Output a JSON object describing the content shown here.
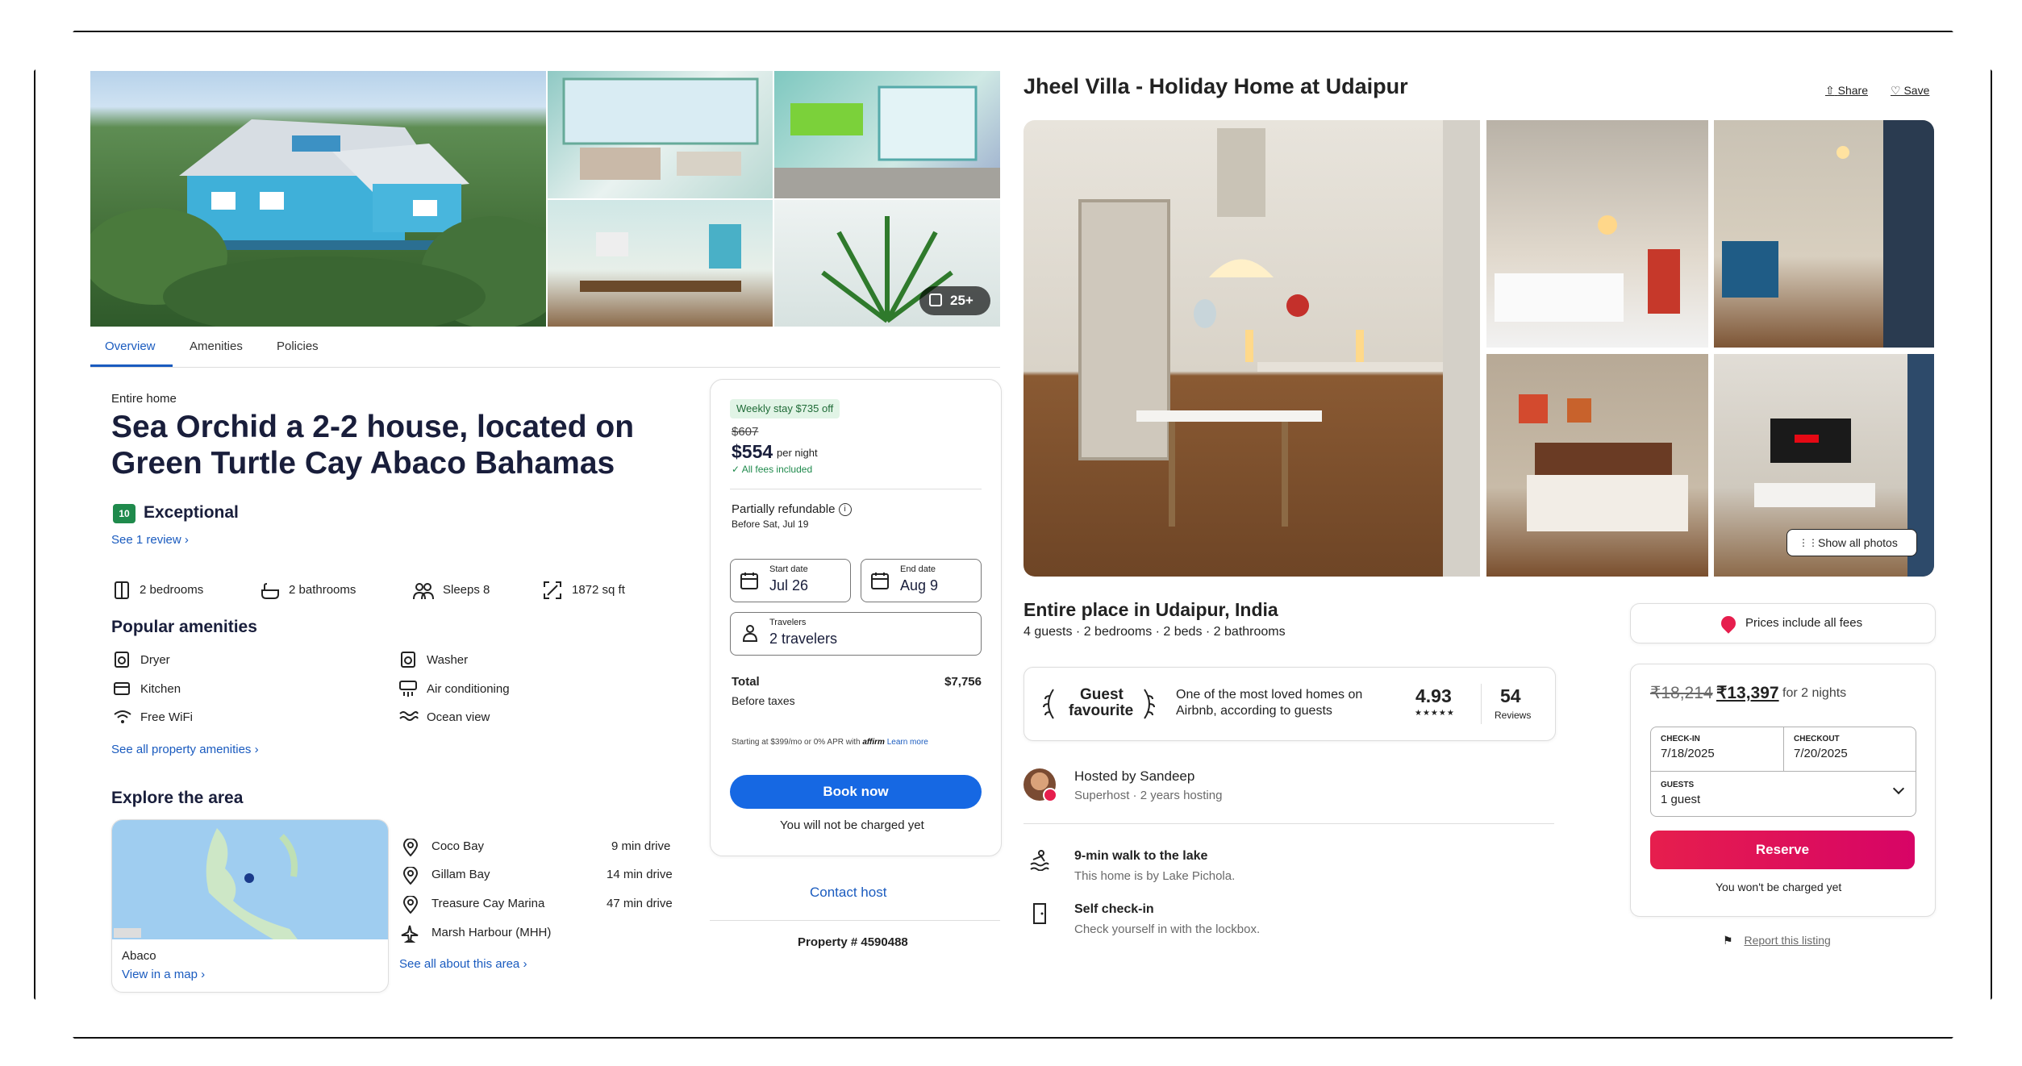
{
  "left": {
    "photo_badge": "25+",
    "tabs": [
      "Overview",
      "Amenities",
      "Policies"
    ],
    "property_type": "Entire home",
    "title_line1": "Sea Orchid a 2-2 house, located on",
    "title_line2": "Green Turtle Cay Abaco Bahamas",
    "rating_score": "10",
    "rating_label": "Exceptional",
    "review_link": "See 1 review",
    "facts": {
      "bedrooms": "2 bedrooms",
      "bathrooms": "2 bathrooms",
      "sleeps": "Sleeps 8",
      "area": "1872 sq ft"
    },
    "amenities_heading": "Popular amenities",
    "amenities": [
      "Dryer",
      "Washer",
      "Kitchen",
      "Air conditioning",
      "Free WiFi",
      "Ocean view"
    ],
    "amenities_link": "See all property amenities",
    "explore_heading": "Explore the area",
    "map_region": "Abaco",
    "map_link": "View in a map",
    "places": [
      {
        "name": "Coco Bay",
        "time": "9 min drive"
      },
      {
        "name": "Gillam Bay",
        "time": "14 min drive"
      },
      {
        "name": "Treasure Cay Marina",
        "time": "47 min drive"
      },
      {
        "name": "Marsh Harbour (MHH)",
        "time": ""
      }
    ],
    "area_link": "See all about this area",
    "booking": {
      "deal_badge": "Weekly stay $735 off",
      "old_price": "$607",
      "price": "$554",
      "per_night": "per night",
      "fees_note": "All fees included",
      "refund": "Partially refundable",
      "refund_date": "Before Sat, Jul 19",
      "start_label": "Start date",
      "start_value": "Jul 26",
      "end_label": "End date",
      "end_value": "Aug 9",
      "travelers_label": "Travelers",
      "travelers_value": "2 travelers",
      "total_label": "Total",
      "total_value": "$7,756",
      "before_taxes": "Before taxes",
      "financing": "Starting at $399/mo or 0% APR with",
      "financing_brand": "affirm",
      "learn_more": "Learn more",
      "book_button": "Book now",
      "no_charge": "You will not be charged yet"
    },
    "contact_host": "Contact host",
    "property_number": "Property # 4590488"
  },
  "right": {
    "title": "Jheel Villa - Holiday Home at Udaipur",
    "share": "Share",
    "save": "Save",
    "show_all_photos": "Show all photos",
    "place_title": "Entire place in Udaipur, India",
    "place_summary": "4 guests · 2 bedrooms · 2 beds · 2 bathrooms",
    "guest_fav_line1": "Guest",
    "guest_fav_line2": "favourite",
    "loved_line1": "One of the most loved homes on",
    "loved_line2": "Airbnb, according to guests",
    "rating": "4.93",
    "stars": "★★★★★",
    "reviews_count": "54",
    "reviews_label": "Reviews",
    "host_line": "Hosted by Sandeep",
    "host_sub": "Superhost · 2 years hosting",
    "feature1_title": "9-min walk to the lake",
    "feature1_sub": "This home is by Lake Pichola.",
    "feature2_title": "Self check-in",
    "feature2_sub": "Check yourself in with the lockbox.",
    "fees_banner": "Prices include all fees",
    "old_price": "₹18,214",
    "price": "₹13,397",
    "price_suffix": "for 2 nights",
    "checkin_label": "CHECK-IN",
    "checkin_value": "7/18/2025",
    "checkout_label": "CHECKOUT",
    "checkout_value": "7/20/2025",
    "guests_label": "GUESTS",
    "guests_value": "1 guest",
    "reserve": "Reserve",
    "no_charge": "You won't be charged yet",
    "report": "Report this listing"
  },
  "colors": {
    "expedia_blue": "#1668e3",
    "airbnb_pink": "#e61e4d",
    "rating_green": "#1f8a4c"
  }
}
